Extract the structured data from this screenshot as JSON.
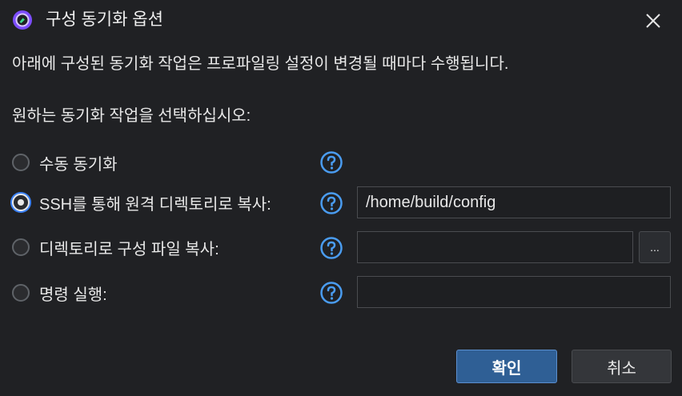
{
  "window": {
    "title": "구성 동기화 옵션",
    "icons": {
      "app": "app-logo-icon",
      "close": "close-icon"
    }
  },
  "description": "아래에 구성된 동기화 작업은 프로파일링 설정이 변경될 때마다 수행됩니다.",
  "prompt": "원하는 동기화 작업을 선택하십시오:",
  "options": [
    {
      "label": "수동 동기화",
      "checked": false
    },
    {
      "label": "SSH를 통해 원격 디렉토리로 복사:",
      "checked": true,
      "field_value": "/home/build/config"
    },
    {
      "label": "디렉토리로 구성 파일 복사:",
      "checked": false,
      "field_value": "",
      "browse_label": "..."
    },
    {
      "label": "명령 실행:",
      "checked": false,
      "field_value": ""
    }
  ],
  "help_icon": "help-question-icon",
  "buttons": {
    "ok": "확인",
    "cancel": "취소"
  },
  "colors": {
    "background": "#202124",
    "accent": "#3b82f6",
    "ok_button": "#2f5f95",
    "help": "#4a9cf0"
  }
}
